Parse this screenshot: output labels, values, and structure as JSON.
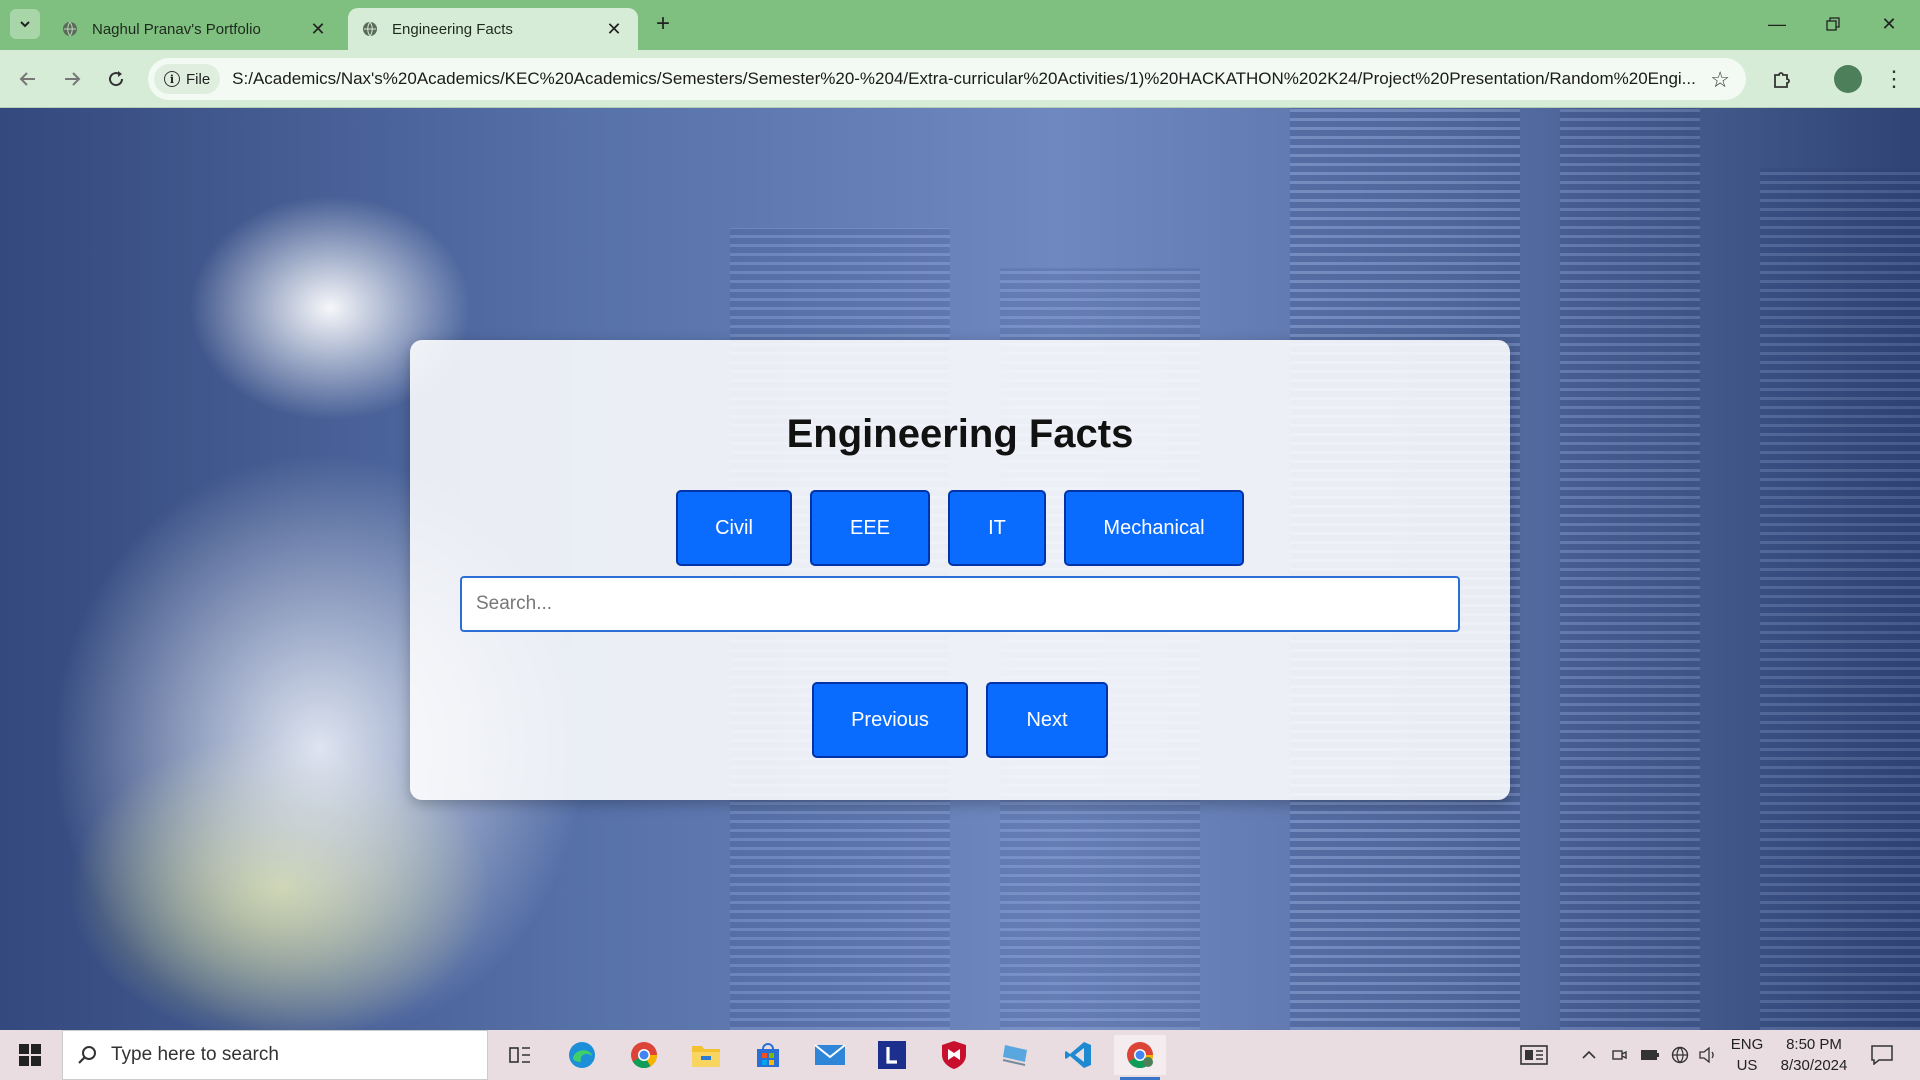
{
  "browser": {
    "tabs": [
      {
        "label": "Naghul Pranav's Portfolio",
        "active": false
      },
      {
        "label": "Engineering Facts",
        "active": true
      }
    ],
    "address": {
      "scheme_chip": "File",
      "url": "S:/Academics/Nax's%20Academics/KEC%20Academics/Semesters/Semester%20-%204/Extra-curricular%20Activities/1)%20HACKATHON%202K24/Project%20Presentation/Random%20Engi..."
    }
  },
  "page": {
    "title": "Engineering Facts",
    "categories": [
      "Civil",
      "EEE",
      "IT",
      "Mechanical"
    ],
    "search": {
      "placeholder": "Search...",
      "value": ""
    },
    "nav": {
      "previous": "Previous",
      "next": "Next"
    }
  },
  "taskbar": {
    "search_placeholder": "Type here to search",
    "language": {
      "line1": "ENG",
      "line2": "US"
    },
    "time": "8:50 PM",
    "date": "8/30/2024"
  },
  "colors": {
    "tabstrip": "#7fbf7f",
    "toolbar": "#d7ecd7",
    "button_bg": "#0a6cff",
    "button_border": "#0033aa",
    "taskbar": "#e9dde2"
  }
}
